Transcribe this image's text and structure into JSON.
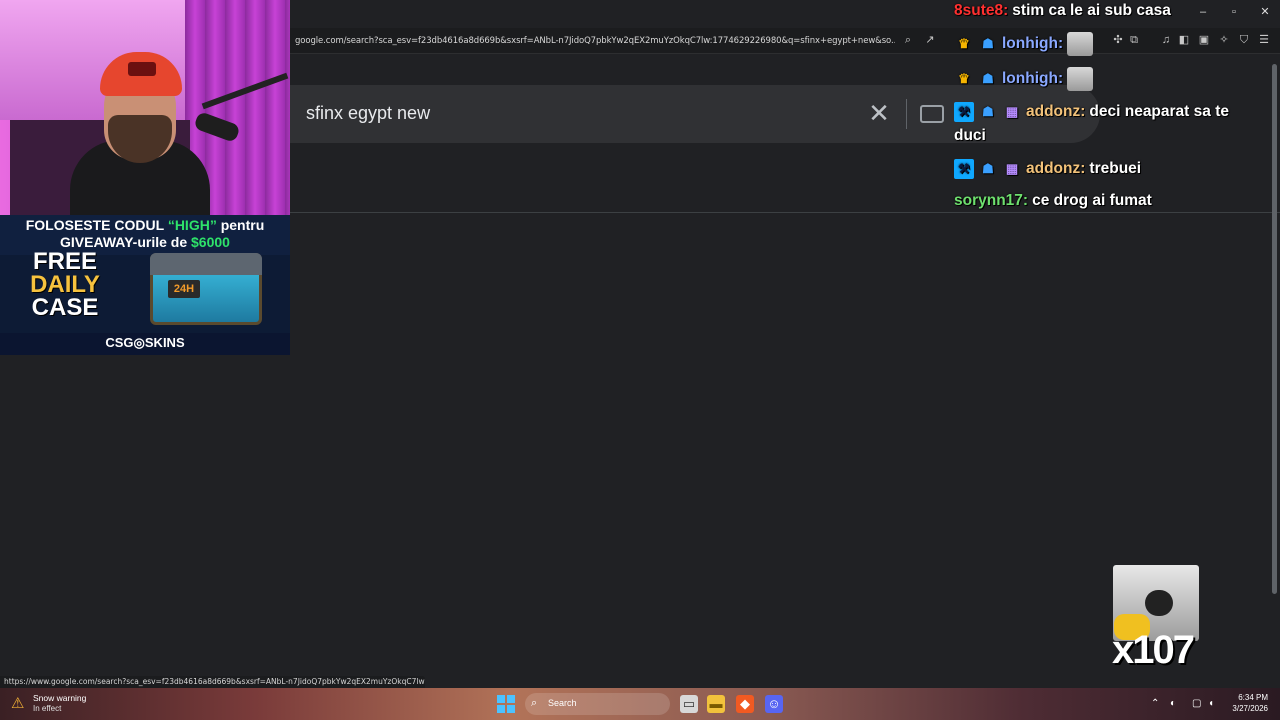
{
  "browser": {
    "url": "google.com/search?sca_esv=f23db4616a8d669b&sxsrf=ANbL-n7JidoQ7pbkYw2qEX2muYzOkqC7lw:1774629226980&q=sfinx+egypt+new&so...",
    "status_url": "https://www.google.com/search?sca_esv=f23db4616a8d669b&sxsrf=ANbL-n7JidoQ7pbkYw2qEX2muYzOkqC7lw:177...",
    "window_controls": {
      "minimize": "–",
      "maximize": "▫",
      "close": "✕"
    }
  },
  "search": {
    "query": "sfinx egypt new",
    "clear_icon": "✕"
  },
  "ad": {
    "line1_prefix": "FOLOSESTE CODUL ",
    "line1_code": "“HIGH”",
    "line1_suffix": " pentru",
    "line2_prefix": "GIVEAWAY-urile de ",
    "line2_amount": "$6000",
    "free": "FREE",
    "daily": "DAILY",
    "case": "CASE",
    "timer_label": "24H",
    "brand": "CSG◎SKINS"
  },
  "chat": {
    "messages": [
      {
        "user": "8sute8:",
        "user_color": "#ff3030",
        "text": "stim ca le ai sub casa"
      },
      {
        "user": "lonhigh:",
        "user_color": "#8aa8ff",
        "text": ""
      },
      {
        "user": "lonhigh:",
        "user_color": "#8aa8ff",
        "text": ""
      },
      {
        "user": "addonz:",
        "user_color": "#f2c27a",
        "text": "deci neaparat sa te"
      },
      {
        "user": "",
        "user_color": "#ffffff",
        "text": "duci"
      },
      {
        "user": "addonz:",
        "user_color": "#f2c27a",
        "text": "trebuei"
      },
      {
        "user": "sorynn17:",
        "user_color": "#6ee06e",
        "text": "ce drog ai fumat"
      }
    ]
  },
  "emote_combo": "x107",
  "taskbar": {
    "weather_title": "Snow warning",
    "weather_sub": "In effect",
    "search_label": "Search",
    "time": "6:34 PM",
    "date": "3/27/2026"
  }
}
